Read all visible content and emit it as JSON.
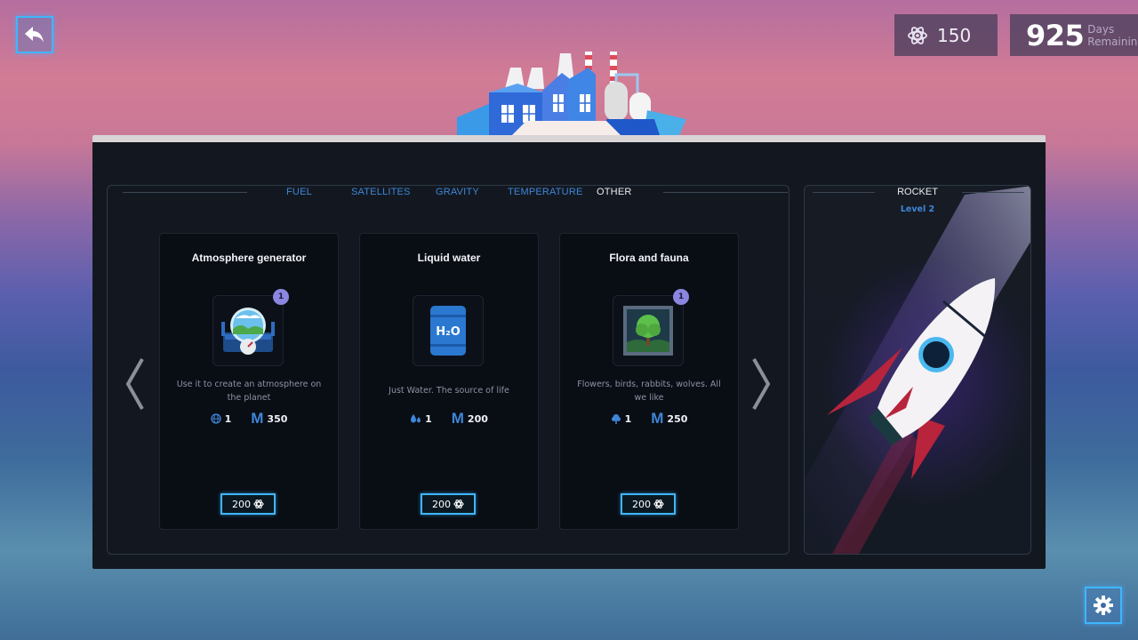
{
  "hud": {
    "atoms": "150",
    "days_value": "925",
    "days_label_1": "Days",
    "days_label_2": "Remaining"
  },
  "tabs": [
    {
      "label": "FUEL",
      "active": false
    },
    {
      "label": "SATELLITES",
      "active": false
    },
    {
      "label": "GRAVITY",
      "active": false
    },
    {
      "label": "TEMPERATURE",
      "active": false
    },
    {
      "label": "OTHER",
      "active": true
    }
  ],
  "cards": [
    {
      "title": "Atmosphere generator",
      "description": "Use it to create an atmosphere on the planet",
      "badge": "1",
      "stat_icon": "globe-icon",
      "stat_value": "1",
      "m_letter": "M",
      "m_value": "350",
      "price": "200"
    },
    {
      "title": "Liquid water",
      "description": "Just Water. The source of life",
      "stat_icon": "water-drops-icon",
      "stat_value": "1",
      "m_letter": "M",
      "m_value": "200",
      "price": "200",
      "icon_text": "H₂O"
    },
    {
      "title": "Flora and fauna",
      "description": "Flowers, birds, rabbits, wolves. All we like",
      "badge": "1",
      "stat_icon": "tree-icon",
      "stat_value": "1",
      "m_letter": "M",
      "m_value": "250",
      "price": "200"
    }
  ],
  "rocket": {
    "title": "ROCKET",
    "level": "Level 2"
  },
  "colors": {
    "accent_blue": "#3e86d8",
    "button_glow": "#3fb6ff",
    "panel_bg": "#131820",
    "badge": "#8c86e0"
  }
}
